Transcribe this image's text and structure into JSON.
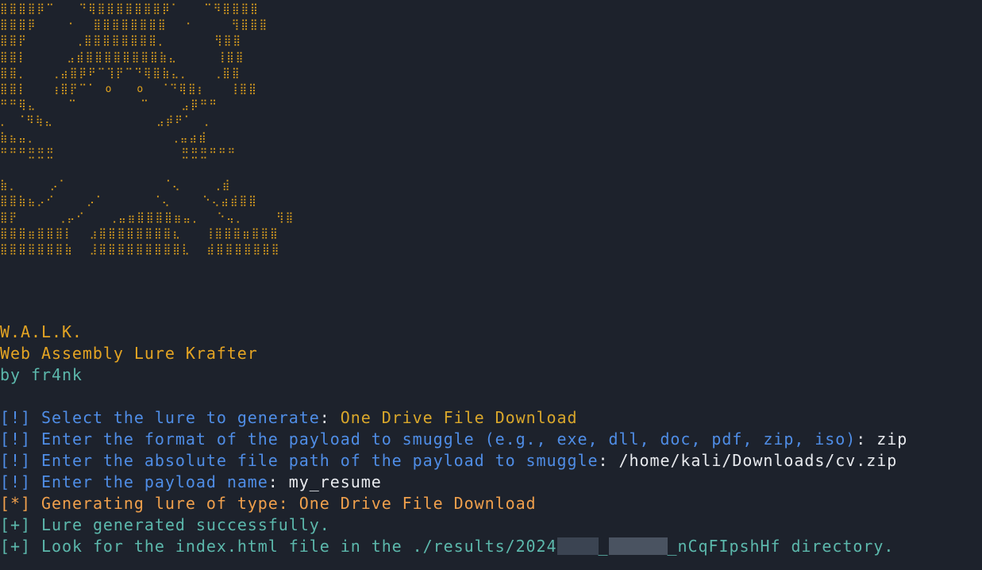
{
  "banner": {
    "art_lines": [
      "⣿⣿⣿⣿⡿⠉   ⠙⢿⣿⣿⣿⣿⣿⣿⣿⡿⠁   ⠉⠻⣿⣿⣿⣿",
      "⣿⣿⣿⡿    ⠂  ⣿⣿⣿⣿⣿⣿⣿⣿  ⠐     ⢻⣿⣿⣿",
      "⣿⣿⡟      ⢀⣿⣿⣿⣿⣿⣿⣿⣿⡀      ⢻⣿⣿",
      "⣿⣿⡇     ⣠⣾⣿⣿⣿⣿⣿⣿⣿⣿⣷⣄     ⢸⣿⣿",
      "⣿⣿⡀   ⢀⣴⣿⡿⠟⠉⢹⡟⠉⠙⢿⣿⣷⣄⡀   ⢀⣿⣿",
      "⣿⣿⡇   ⢰⣿⡟⠉⠁ o   o  ⠈⠙⢿⣿⡆   ⢸⣿⣿",
      "⠛⠛⢿⣄    ⠉        ⠉    ⣠⡿⠛⠛",
      "⡀ ⠈⠻⢷⣄             ⣠⡾⠟⠁ ⢀",
      "⣷⣦⣤⡀                 ⢀⣤⣴⣾",
      "⠛⠛⠛⣛⣛⣛                ⣛⣛⣛⠛⠛⠛",
      "",
      "⣷⡀    ⡠⠁            ⠈⢄    ⢀⣾",
      "⣿⣿⣷⣦⡠⠊    ⡠⠁      ⠈⢄    ⠑⢄⣴⣾⣿⣿",
      "⣿⡟     ⢀⡤⠊   ⢀⣤⣶⣿⣿⣿⣿⣶⣤⡀  ⠑⢤⡀    ⢻⣿",
      "⣿⣿⣿⣶⣿⣿⣿⡇  ⣰⣿⣿⣿⣿⣿⣿⣿⣿⣆   ⢸⣿⣿⣿⣶⣿⣿⣿",
      "⣿⣿⣿⣿⣿⣿⣿⣷  ⣸⣿⣿⣿⣿⣿⣿⣿⣿⣿⣇  ⣾⣿⣿⣿⣿⣿⣿⣿"
    ],
    "acronym": "W.A.L.K.",
    "title": "Web Assembly Lure Krafter",
    "author": "by fr4nk"
  },
  "prompts": [
    {
      "bracket": "[!]",
      "question": "Select the lure to generate",
      "sep": ": ",
      "answer": "One Drive File Download"
    },
    {
      "bracket": "[!]",
      "question": "Enter the format of the payload to smuggle (e.g., exe, dll, doc, pdf, zip, iso)",
      "sep": ": ",
      "answer": "zip"
    },
    {
      "bracket": "[!]",
      "question": "Enter the absolute file path of the payload to smuggle",
      "sep": ": ",
      "answer": "/home/kali/Downloads/cv.zip"
    },
    {
      "bracket": "[!]",
      "question": "Enter the payload name",
      "sep": ": ",
      "answer": "my_resume"
    }
  ],
  "status": {
    "generating": {
      "bracket": "[*]",
      "text": "Generating lure of type: One Drive File Download"
    },
    "success": {
      "bracket": "[+]",
      "text": "Lure generated successfully."
    },
    "result": {
      "bracket": "[+]",
      "prefix": "Look for the index.html file in the ./results/2024",
      "sep1": "_",
      "sep2": "_nCqFIpshHf directory."
    }
  },
  "colors": {
    "background": "#1d222c",
    "banner": "#e0a21e",
    "prompt": "#4f8de6",
    "success": "#5cb8ac",
    "generating": "#f0a04c",
    "answer": "#e8eaee"
  }
}
